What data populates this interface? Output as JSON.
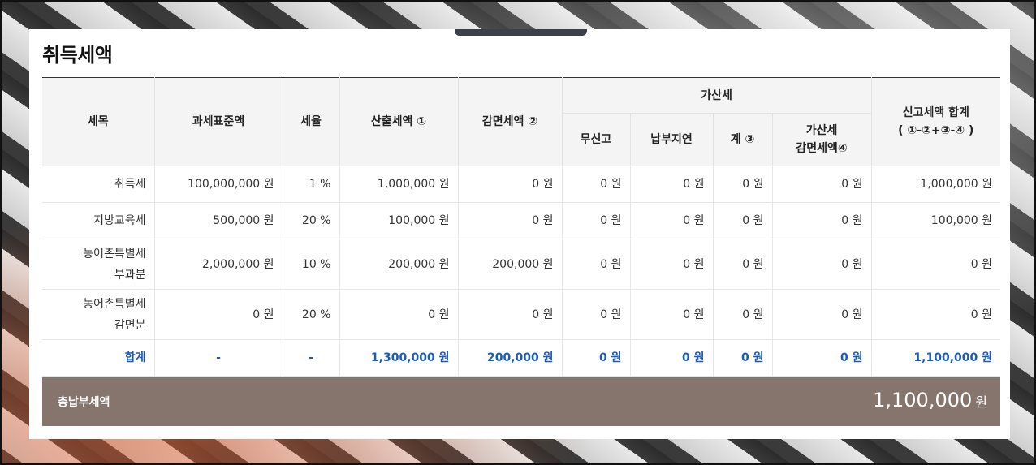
{
  "title": "취득세액",
  "headers": {
    "item": "세목",
    "base": "과세표준액",
    "rate": "세율",
    "calc": "산출세액 ①",
    "reduction": "감면세액 ②",
    "penalty_group": "가산세",
    "penalty_unreported": "무신고",
    "penalty_late": "납부지연",
    "penalty_sum": "계 ③",
    "penalty_reduction_line1": "가산세",
    "penalty_reduction_line2": "감면세액④",
    "report_total_line1": "신고세액 합계",
    "report_total_line2": "( ①-②+③-④ )"
  },
  "rows": [
    {
      "item": "취득세",
      "base": "100,000,000 원",
      "rate": "1 %",
      "calc": "1,000,000 원",
      "reduction": "0 원",
      "unreported": "0 원",
      "late": "0 원",
      "penalty_sum": "0 원",
      "penalty_reduction": "0 원",
      "report_total": "1,000,000 원"
    },
    {
      "item": "지방교육세",
      "base": "500,000 원",
      "rate": "20 %",
      "calc": "100,000 원",
      "reduction": "0 원",
      "unreported": "0 원",
      "late": "0 원",
      "penalty_sum": "0 원",
      "penalty_reduction": "0 원",
      "report_total": "100,000 원"
    },
    {
      "item_line1": "농어촌특별세",
      "item_line2": "부과분",
      "base": "2,000,000 원",
      "rate": "10 %",
      "calc": "200,000 원",
      "reduction": "200,000 원",
      "unreported": "0 원",
      "late": "0 원",
      "penalty_sum": "0 원",
      "penalty_reduction": "0 원",
      "report_total": "0 원"
    },
    {
      "item_line1": "농어촌특별세",
      "item_line2": "감면분",
      "base": "0 원",
      "rate": "20 %",
      "calc": "0 원",
      "reduction": "0 원",
      "unreported": "0 원",
      "late": "0 원",
      "penalty_sum": "0 원",
      "penalty_reduction": "0 원",
      "report_total": "0 원"
    }
  ],
  "total_row": {
    "item": "합계",
    "base": "-",
    "rate": "-",
    "calc": "1,300,000 원",
    "reduction": "200,000 원",
    "unreported": "0 원",
    "late": "0 원",
    "penalty_sum": "0 원",
    "penalty_reduction": "0 원",
    "report_total": "1,100,000 원"
  },
  "grand_total": {
    "label": "총납부세액",
    "value": "1,100,000",
    "unit": "원"
  },
  "colors": {
    "total_text": "#1a5bb5",
    "total_bar": "#86756d",
    "header_bg": "#f4f4f4"
  }
}
